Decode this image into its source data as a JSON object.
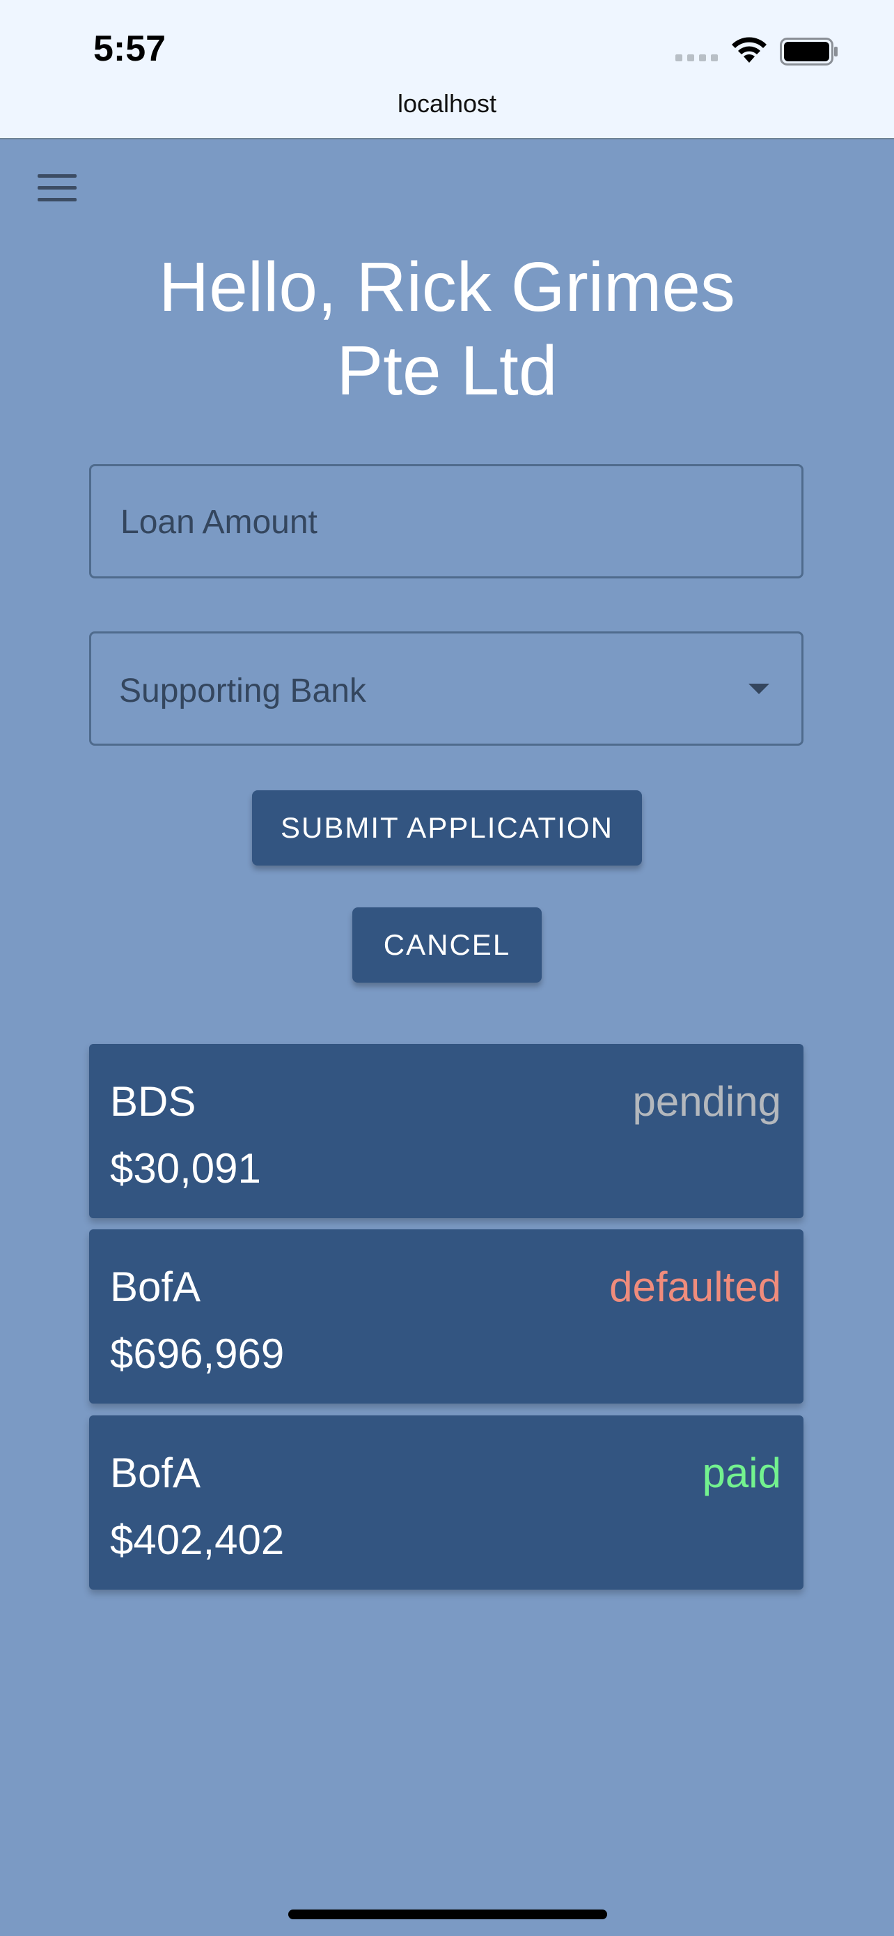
{
  "status_bar": {
    "time": "5:57",
    "url": "localhost"
  },
  "header": {
    "menu_icon": "hamburger-menu-icon",
    "greeting_line1": "Hello, Rick Grimes",
    "greeting_line2": "Pte Ltd"
  },
  "form": {
    "loan_amount_placeholder": "Loan Amount",
    "loan_amount_value": "",
    "supporting_bank_placeholder": "Supporting Bank",
    "submit_label": "SUBMIT APPLICATION",
    "cancel_label": "CANCEL"
  },
  "loans": [
    {
      "bank": "BDS",
      "amount": "$30,091",
      "status": "pending",
      "status_color": "#b4b8bd"
    },
    {
      "bank": "BofA",
      "amount": "$696,969",
      "status": "defaulted",
      "status_color": "#f08c7c"
    },
    {
      "bank": "BofA",
      "amount": "$402,402",
      "status": "paid",
      "status_color": "#73f28f"
    }
  ],
  "colors": {
    "background": "#7b9ac4",
    "primary": "#335581",
    "status_bar": "#eff6ff"
  }
}
